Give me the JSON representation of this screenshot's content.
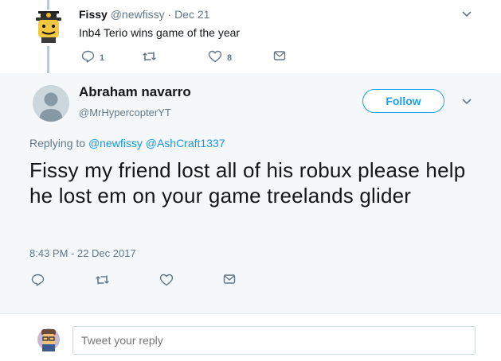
{
  "parent_tweet": {
    "name": "Fissy",
    "handle": "@newfissy",
    "separator": " · ",
    "date": "Dec 21",
    "text": "Inb4 Terio wins game of the year",
    "reply_count": "1",
    "like_count": "8"
  },
  "main_tweet": {
    "name": "Abraham navarro",
    "handle": "@MrHypercopterYT",
    "follow_label": "Follow",
    "replying_prefix": "Replying to ",
    "mention_1": "@newfissy",
    "mention_2": "@AshCraft1337",
    "text": "Fissy my friend lost all of his robux please help he lost em on your game treelands glider",
    "timestamp": "8:43 PM - 22 Dec 2017"
  },
  "reply_box": {
    "placeholder": "Tweet your reply"
  },
  "colors": {
    "accent": "#1da1f2",
    "thread_line": "#a9cfe7",
    "muted_text": "#657786",
    "main_background": "#f5f8fa"
  },
  "icons": [
    "reply-icon",
    "retweet-icon",
    "heart-icon",
    "envelope-icon",
    "chevron-down-icon",
    "default-avatar-icon"
  ]
}
